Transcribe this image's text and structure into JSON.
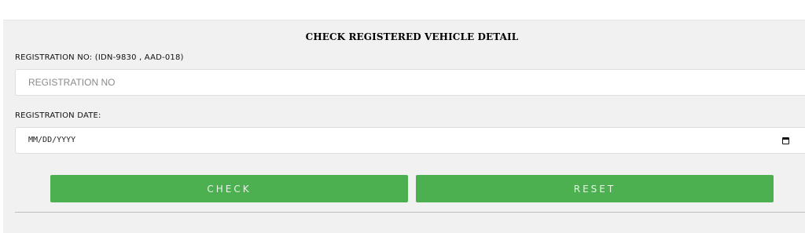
{
  "form": {
    "title": "CHECK REGISTERED VEHICLE DETAIL",
    "registration_label": "REGISTRATION NO: (IDN-9830 , AAD-018)",
    "registration_placeholder": "REGISTRATION NO",
    "registration_value": "",
    "date_label": "REGISTRATION DATE:",
    "date_placeholder": "MM/DD/YYYY",
    "date_icon": "calendar-icon",
    "check_label": "CHECK",
    "reset_label": "RESET"
  },
  "colors": {
    "panel_background": "#f1f1f1",
    "button_green": "#4caf50",
    "button_text": "#e8f5e8"
  }
}
